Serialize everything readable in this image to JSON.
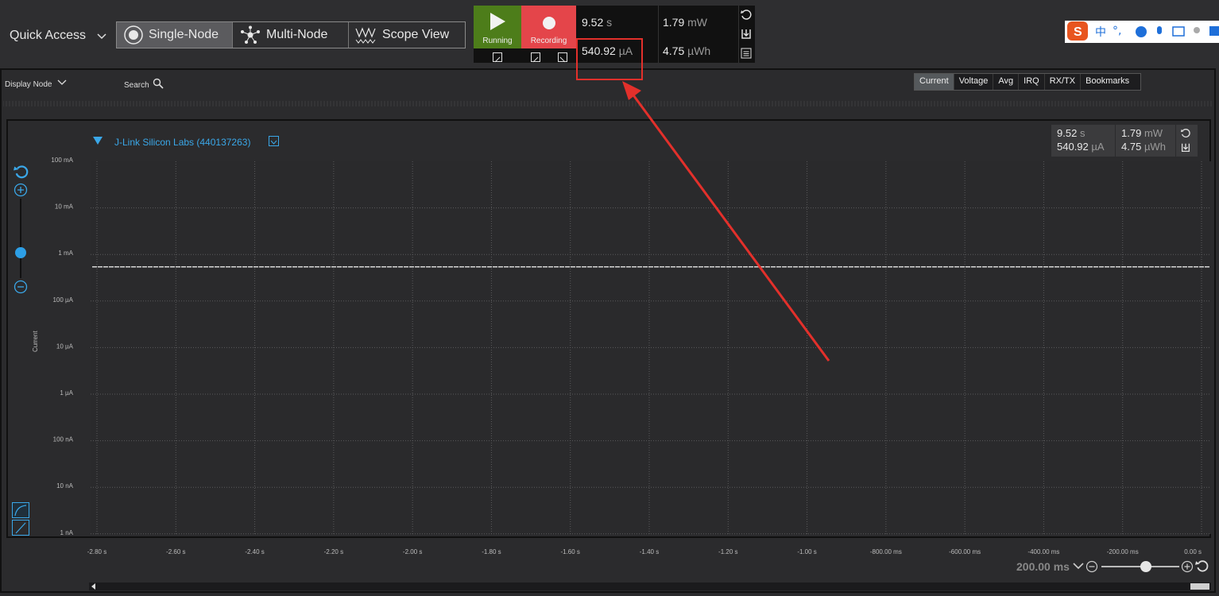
{
  "header": {
    "quick_access": "Quick Access",
    "modes": [
      {
        "label": "Single-Node",
        "icon": "radio-icon",
        "active": true
      },
      {
        "label": "Multi-Node",
        "icon": "network-icon",
        "active": false
      },
      {
        "label": "Scope View",
        "icon": "waveform-icon",
        "active": false
      }
    ]
  },
  "controls": {
    "run_label": "Running",
    "record_label": "Recording",
    "run_color": "#4d7d1a",
    "record_color": "#e4454a"
  },
  "stats": {
    "time": "9.52",
    "time_unit": "s",
    "power": "1.79",
    "power_unit": "mW",
    "current": "540.92",
    "current_unit": "µA",
    "energy": "4.75",
    "energy_unit": "µWh"
  },
  "toolbar": {
    "display_node": "Display Node",
    "search": "Search"
  },
  "tabs": [
    "Current",
    "Voltage",
    "Avg",
    "IRQ",
    "RX/TX",
    "Bookmarks"
  ],
  "chart_data": {
    "type": "line",
    "device": "J-Link Silicon Labs (440137263)",
    "ylabel": "Current",
    "yscale": "log",
    "y_ticks": [
      "100 mA",
      "10 mA",
      "1 mA",
      "100 µA",
      "10 µA",
      "1 µA",
      "100 nA",
      "10 nA",
      "1 nA"
    ],
    "x_ticks": [
      "-2.80 s",
      "-2.60 s",
      "-2.40 s",
      "-2.20 s",
      "-2.00 s",
      "-1.80 s",
      "-1.60 s",
      "-1.40 s",
      "-1.20 s",
      "-1.00 s",
      "-800.00 ms",
      "-600.00 ms",
      "-400.00 ms",
      "-200.00 ms",
      "0.00 s"
    ],
    "xlim_s": [
      -2.8,
      0
    ],
    "series": [
      {
        "color": "#e8e8e8",
        "x_s": [
          -2.8,
          0
        ],
        "y_A": [
          0.00054092,
          0.00054092
        ]
      }
    ],
    "grid": true,
    "zoom": "200.00 ms"
  },
  "annotation": {
    "color": "#e3302b"
  }
}
